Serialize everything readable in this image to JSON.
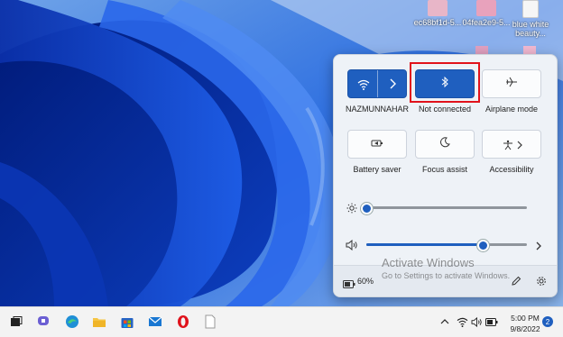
{
  "desktop": {
    "icons": [
      {
        "label": "ec68bf1d-5..."
      },
      {
        "label": "04fea2e9-5..."
      },
      {
        "label": "blue white beauty..."
      }
    ]
  },
  "quick_settings": {
    "wifi": {
      "label": "NAZMUNNAHAR"
    },
    "bluetooth": {
      "label": "Not connected",
      "state": "on"
    },
    "airplane": {
      "label": "Airplane mode"
    },
    "battery_saver": {
      "label": "Battery saver"
    },
    "focus_assist": {
      "label": "Focus assist"
    },
    "accessibility": {
      "label": "Accessibility"
    },
    "brightness": {
      "level": 0.0
    },
    "volume": {
      "level": 0.73
    },
    "battery": {
      "percent": "60%"
    }
  },
  "watermark": {
    "title": "Activate Windows",
    "subtitle": "Go to Settings to activate Windows."
  },
  "taskbar": {
    "clock": {
      "time": "5:00 PM",
      "date": "9/8/2022"
    },
    "notifications": "2"
  },
  "colors": {
    "accent": "#1f5fbf",
    "highlight": "#e1121b"
  }
}
